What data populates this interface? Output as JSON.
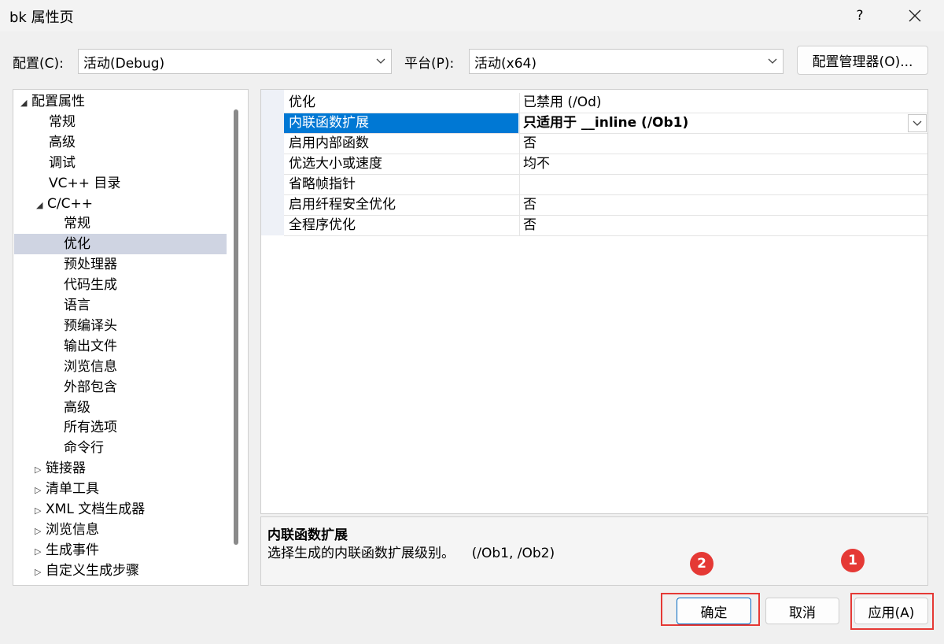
{
  "window": {
    "title": "bk 属性页",
    "help": "?"
  },
  "config": {
    "config_label": "配置(C):",
    "config_value": "活动(Debug)",
    "platform_label": "平台(P):",
    "platform_value": "活动(x64)",
    "manager_button": "配置管理器(O)..."
  },
  "tree": {
    "items": [
      {
        "label": "配置属性",
        "arrow": "◢"
      },
      {
        "label": "常规"
      },
      {
        "label": "高级"
      },
      {
        "label": "调试"
      },
      {
        "label": "VC++ 目录"
      },
      {
        "label": "C/C++",
        "arrow": "◢"
      },
      {
        "label": "常规"
      },
      {
        "label": "优化",
        "selected": true
      },
      {
        "label": "预处理器"
      },
      {
        "label": "代码生成"
      },
      {
        "label": "语言"
      },
      {
        "label": "预编译头"
      },
      {
        "label": "输出文件"
      },
      {
        "label": "浏览信息"
      },
      {
        "label": "外部包含"
      },
      {
        "label": "高级"
      },
      {
        "label": "所有选项"
      },
      {
        "label": "命令行"
      },
      {
        "label": "链接器",
        "arrow": "▷"
      },
      {
        "label": "清单工具",
        "arrow": "▷"
      },
      {
        "label": "XML 文档生成器",
        "arrow": "▷"
      },
      {
        "label": "浏览信息",
        "arrow": "▷"
      },
      {
        "label": "生成事件",
        "arrow": "▷"
      },
      {
        "label": "自定义生成步骤",
        "arrow": "▷"
      }
    ]
  },
  "properties": [
    {
      "name": "优化",
      "value": "已禁用 (/Od)"
    },
    {
      "name": "内联函数扩展",
      "value": "只适用于 __inline (/Ob1)",
      "selected": true
    },
    {
      "name": "启用内部函数",
      "value": "否"
    },
    {
      "name": "优选大小或速度",
      "value": "均不"
    },
    {
      "name": "省略帧指针",
      "value": ""
    },
    {
      "name": "启用纤程安全优化",
      "value": "否"
    },
    {
      "name": "全程序优化",
      "value": "否"
    }
  ],
  "description": {
    "title": "内联函数扩展",
    "text": "选择生成的内联函数扩展级别。    (/Ob1, /Ob2)"
  },
  "buttons": {
    "ok": "确定",
    "cancel": "取消",
    "apply": "应用(A)"
  },
  "annotations": {
    "badge_apply": "1",
    "badge_ok": "2"
  },
  "colors": {
    "selection": "#0078d4",
    "tree_selection": "#cfd4e2",
    "annotation_red": "#e53935"
  }
}
